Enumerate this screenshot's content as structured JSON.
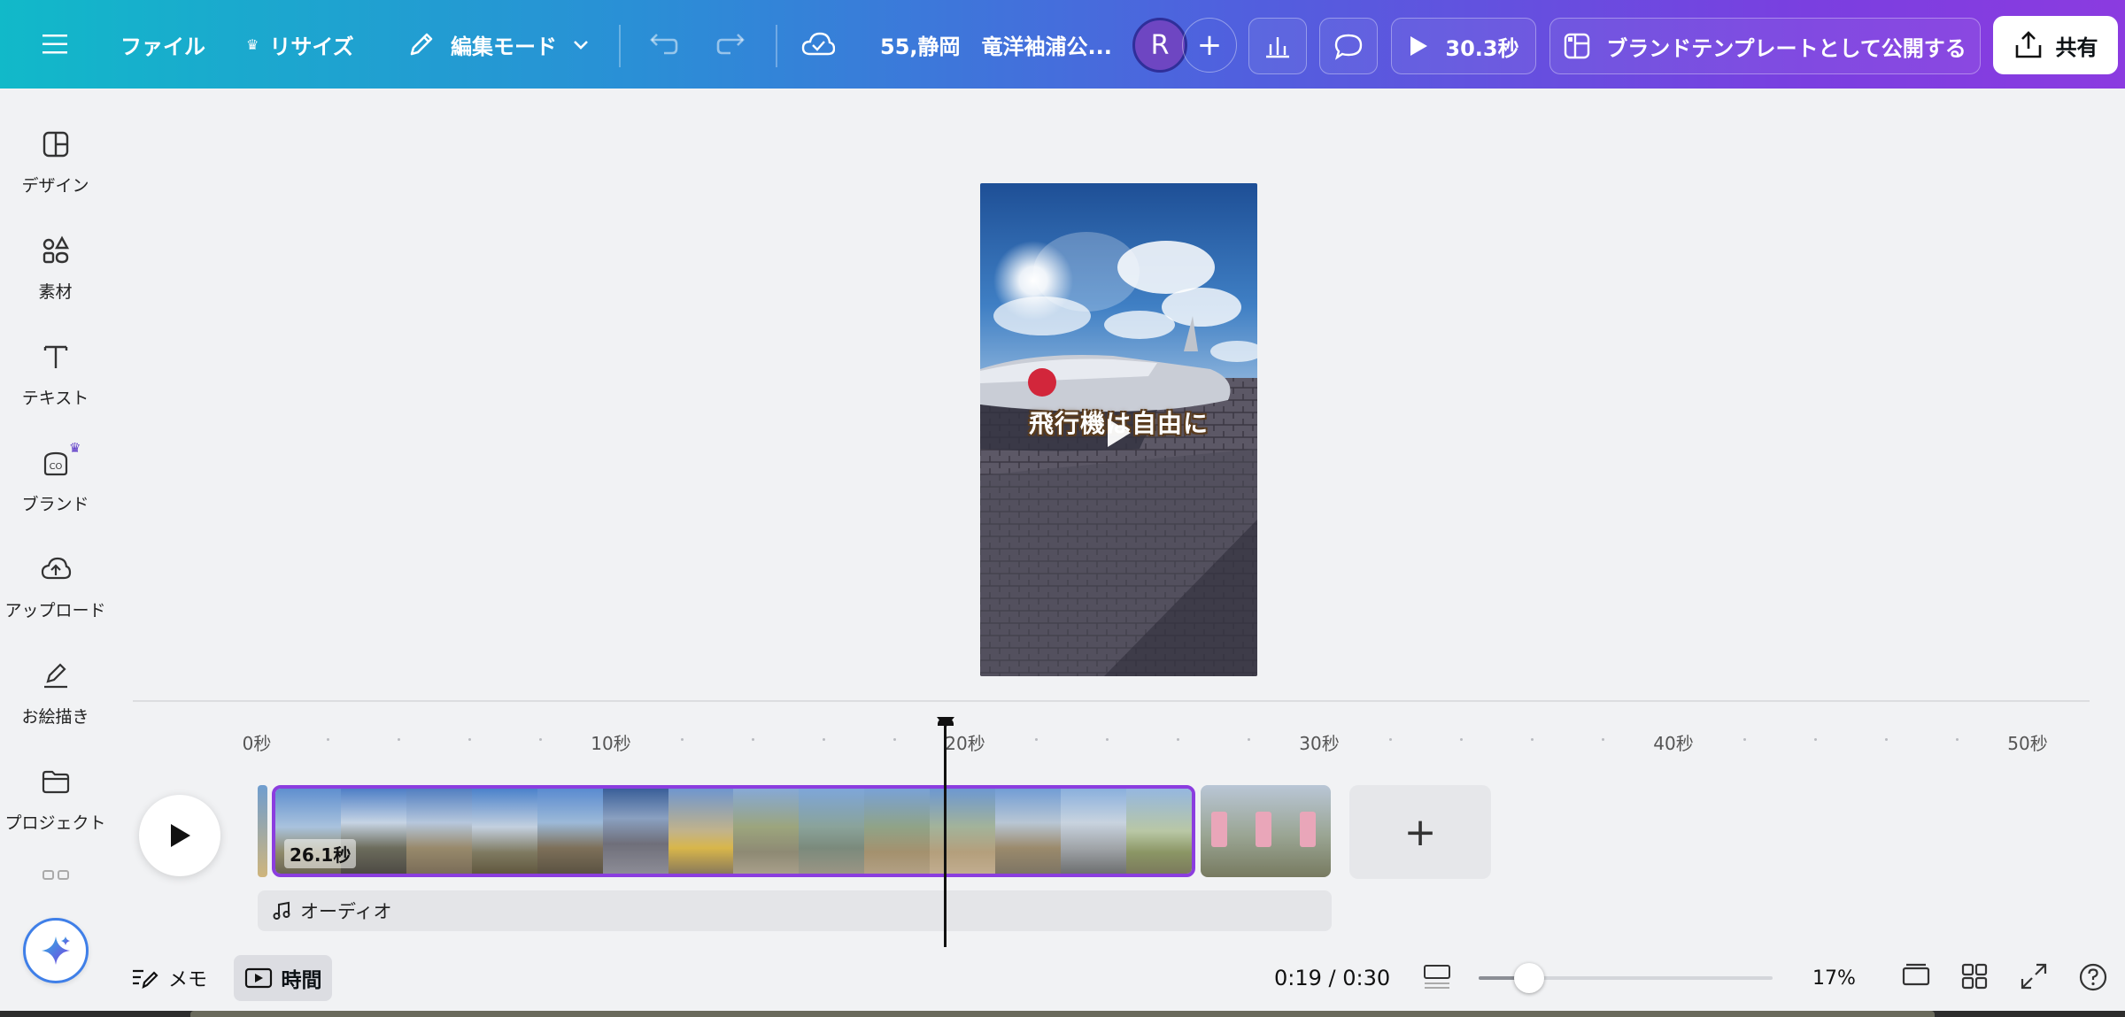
{
  "app": {
    "accent": "#8b3ddf",
    "gradient": [
      "#11b9c9",
      "#5060de",
      "#8b3be0"
    ]
  },
  "topbar": {
    "menu_icon": "hamburger-icon",
    "file_label": "ファイル",
    "resize_label": "リサイズ",
    "edit_mode_label": "編集モード",
    "project_title": "55,静岡　竜洋袖浦公...",
    "avatar_initial": "R",
    "play_duration": "30.3秒",
    "publish_template_label": "ブランドテンプレートとして公開する",
    "share_label": "共有"
  },
  "sidebar": {
    "items": [
      {
        "label": "デザイン",
        "icon": "design-layout-icon"
      },
      {
        "label": "素材",
        "icon": "elements-icon"
      },
      {
        "label": "テキスト",
        "icon": "text-icon"
      },
      {
        "label": "ブランド",
        "icon": "brand-icon"
      },
      {
        "label": "アップロード",
        "icon": "upload-cloud-icon"
      },
      {
        "label": "お絵描き",
        "icon": "draw-pen-icon"
      },
      {
        "label": "プロジェクト",
        "icon": "folder-icon"
      }
    ]
  },
  "canvas": {
    "caption": "飛行機は自由に"
  },
  "timeline": {
    "ruler": [
      "0秒",
      "10秒",
      "20秒",
      "30秒",
      "40秒",
      "50秒"
    ],
    "clip_duration": "26.1秒",
    "audio_label": "オーディオ",
    "playhead_seconds": 19
  },
  "bottombar": {
    "notes_label": "メモ",
    "timer_label": "時間",
    "time_readout": "0:19 / 0:30",
    "zoom_level": "17%",
    "zoom_fraction": 0.17
  }
}
